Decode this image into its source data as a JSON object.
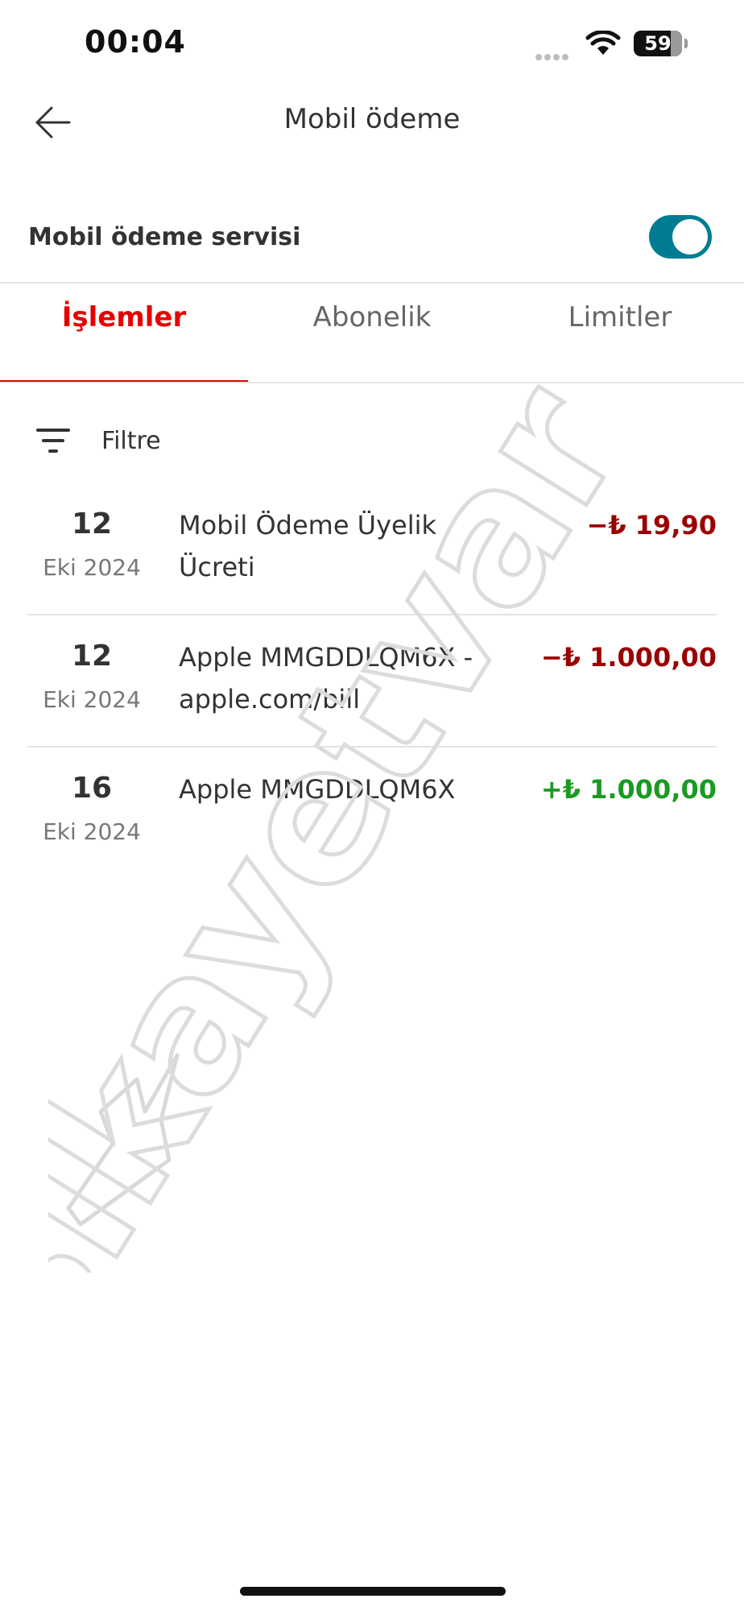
{
  "status_bar": {
    "time": "00:04",
    "battery": "59",
    "icons": [
      "signal-dots-icon",
      "wifi-icon",
      "battery-icon"
    ]
  },
  "header": {
    "title": "Mobil ödeme",
    "back_icon": "arrow-left-icon"
  },
  "service": {
    "label": "Mobil ödeme servisi",
    "enabled": true,
    "toggle_color": "#007c92"
  },
  "tabs": [
    {
      "label": "İşlemler",
      "active": true
    },
    {
      "label": "Abonelik",
      "active": false
    },
    {
      "label": "Limitler",
      "active": false
    }
  ],
  "filter": {
    "label": "Filtre",
    "icon": "filter-icon"
  },
  "transactions": [
    {
      "day": "12",
      "month": "Eki 2024",
      "description": "Mobil Ödeme Üyelik Ücreti",
      "amount": "−₺ 19,90",
      "sign": "negative"
    },
    {
      "day": "12",
      "month": "Eki 2024",
      "description": "Apple MMGDDLQM6X - apple.com/bill",
      "amount": "−₺ 1.000,00",
      "sign": "negative"
    },
    {
      "day": "16",
      "month": "Eki 2024",
      "description": "Apple MMGDDLQM6X",
      "amount": "+₺ 1.000,00",
      "sign": "positive"
    }
  ],
  "watermark": {
    "text": "şikayetvar"
  },
  "colors": {
    "accent": "#e60000",
    "negative": "#9b0000",
    "positive": "#1a9a22"
  }
}
